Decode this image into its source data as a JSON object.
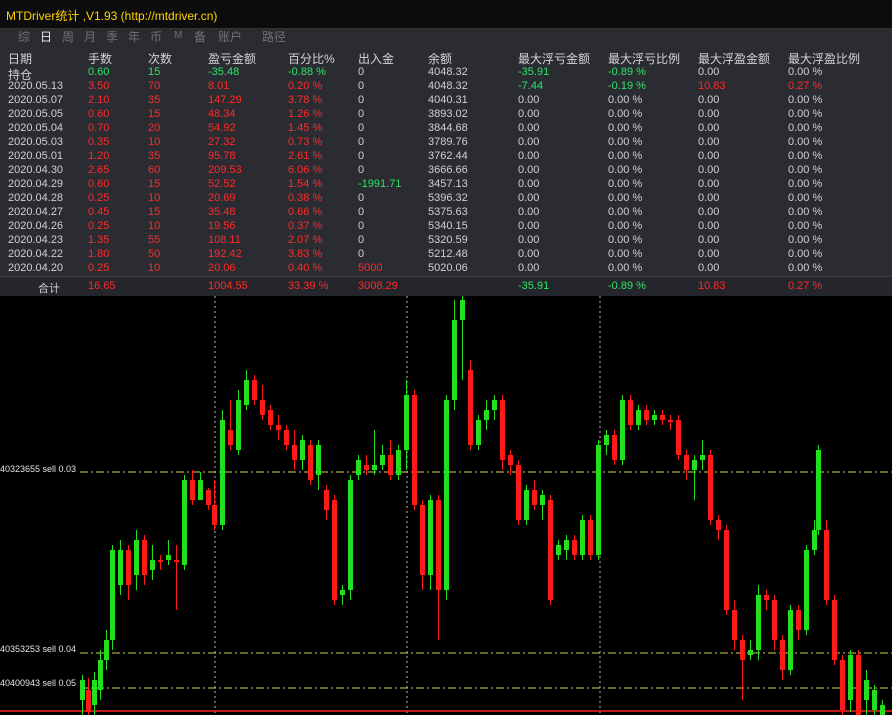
{
  "app": {
    "title": "MTDriver统计 ,V1.93 (http://mtdriver.cn)"
  },
  "tabs": [
    {
      "label": "综",
      "active": false
    },
    {
      "label": "日",
      "active": true
    },
    {
      "label": "周",
      "active": false
    },
    {
      "label": "月",
      "active": false
    },
    {
      "label": "季",
      "active": false
    },
    {
      "label": "年",
      "active": false
    },
    {
      "label": "币",
      "active": false
    },
    {
      "label": "M",
      "active": false
    },
    {
      "label": "备",
      "active": false
    },
    {
      "label": "账户",
      "active": false
    },
    {
      "label": "路径",
      "active": false
    }
  ],
  "table": {
    "headers": [
      "日期",
      "手数",
      "次数",
      "盈亏金额",
      "百分比%",
      "出入金",
      "余额",
      "最大浮亏金额",
      "最大浮亏比例",
      "最大浮盈金额",
      "最大浮盈比例"
    ],
    "rows": [
      {
        "date": "持仓",
        "lots": "0.60",
        "count": "15",
        "pnl": "-35.48",
        "pct": "-0.88 %",
        "flow": "0",
        "balance": "4048.32",
        "maxloss": "-35.91",
        "maxlosspct": "-0.89 %",
        "maxgain": "0.00",
        "maxgainpct": "0.00 %",
        "sign": "g"
      },
      {
        "date": "2020.05.13",
        "lots": "3.50",
        "count": "70",
        "pnl": "8.01",
        "pct": "0.20 %",
        "flow": "0",
        "balance": "4048.32",
        "maxloss": "-7.44",
        "maxlosspct": "-0.19 %",
        "maxgain": "10.83",
        "maxgainpct": "0.27 %",
        "sign": "r"
      },
      {
        "date": "2020.05.07",
        "lots": "2.10",
        "count": "35",
        "pnl": "147.29",
        "pct": "3.78 %",
        "flow": "0",
        "balance": "4040.31",
        "maxloss": "0.00",
        "maxlosspct": "0.00 %",
        "maxgain": "0.00",
        "maxgainpct": "0.00 %",
        "sign": "r"
      },
      {
        "date": "2020.05.05",
        "lots": "0.60",
        "count": "15",
        "pnl": "48.34",
        "pct": "1.26 %",
        "flow": "0",
        "balance": "3893.02",
        "maxloss": "0.00",
        "maxlosspct": "0.00 %",
        "maxgain": "0.00",
        "maxgainpct": "0.00 %",
        "sign": "r"
      },
      {
        "date": "2020.05.04",
        "lots": "0.70",
        "count": "20",
        "pnl": "54.92",
        "pct": "1.45 %",
        "flow": "0",
        "balance": "3844.68",
        "maxloss": "0.00",
        "maxlosspct": "0.00 %",
        "maxgain": "0.00",
        "maxgainpct": "0.00 %",
        "sign": "r"
      },
      {
        "date": "2020.05.03",
        "lots": "0.35",
        "count": "10",
        "pnl": "27.32",
        "pct": "0.73 %",
        "flow": "0",
        "balance": "3789.76",
        "maxloss": "0.00",
        "maxlosspct": "0.00 %",
        "maxgain": "0.00",
        "maxgainpct": "0.00 %",
        "sign": "r"
      },
      {
        "date": "2020.05.01",
        "lots": "1.20",
        "count": "35",
        "pnl": "95.78",
        "pct": "2.61 %",
        "flow": "0",
        "balance": "3762.44",
        "maxloss": "0.00",
        "maxlosspct": "0.00 %",
        "maxgain": "0.00",
        "maxgainpct": "0.00 %",
        "sign": "r"
      },
      {
        "date": "2020.04.30",
        "lots": "2.65",
        "count": "60",
        "pnl": "209.53",
        "pct": "6.06 %",
        "flow": "0",
        "balance": "3666.66",
        "maxloss": "0.00",
        "maxlosspct": "0.00 %",
        "maxgain": "0.00",
        "maxgainpct": "0.00 %",
        "sign": "r"
      },
      {
        "date": "2020.04.29",
        "lots": "0.60",
        "count": "15",
        "pnl": "52.52",
        "pct": "1.54 %",
        "flow": "-1991.71",
        "balance": "3457.13",
        "maxloss": "0.00",
        "maxlosspct": "0.00 %",
        "maxgain": "0.00",
        "maxgainpct": "0.00 %",
        "sign": "r",
        "flowcolor": "g"
      },
      {
        "date": "2020.04.28",
        "lots": "0.25",
        "count": "10",
        "pnl": "20.69",
        "pct": "0.38 %",
        "flow": "0",
        "balance": "5396.32",
        "maxloss": "0.00",
        "maxlosspct": "0.00 %",
        "maxgain": "0.00",
        "maxgainpct": "0.00 %",
        "sign": "r"
      },
      {
        "date": "2020.04.27",
        "lots": "0.45",
        "count": "15",
        "pnl": "35.48",
        "pct": "0.66 %",
        "flow": "0",
        "balance": "5375.63",
        "maxloss": "0.00",
        "maxlosspct": "0.00 %",
        "maxgain": "0.00",
        "maxgainpct": "0.00 %",
        "sign": "r"
      },
      {
        "date": "2020.04.26",
        "lots": "0.25",
        "count": "10",
        "pnl": "19.56",
        "pct": "0.37 %",
        "flow": "0",
        "balance": "5340.15",
        "maxloss": "0.00",
        "maxlosspct": "0.00 %",
        "maxgain": "0.00",
        "maxgainpct": "0.00 %",
        "sign": "r"
      },
      {
        "date": "2020.04.23",
        "lots": "1.35",
        "count": "55",
        "pnl": "108.11",
        "pct": "2.07 %",
        "flow": "0",
        "balance": "5320.59",
        "maxloss": "0.00",
        "maxlosspct": "0.00 %",
        "maxgain": "0.00",
        "maxgainpct": "0.00 %",
        "sign": "r"
      },
      {
        "date": "2020.04.22",
        "lots": "1.80",
        "count": "50",
        "pnl": "192.42",
        "pct": "3.83 %",
        "flow": "0",
        "balance": "5212.48",
        "maxloss": "0.00",
        "maxlosspct": "0.00 %",
        "maxgain": "0.00",
        "maxgainpct": "0.00 %",
        "sign": "r"
      },
      {
        "date": "2020.04.20",
        "lots": "0.25",
        "count": "10",
        "pnl": "20.06",
        "pct": "0.40 %",
        "flow": "5000",
        "balance": "5020.06",
        "maxloss": "0.00",
        "maxlosspct": "0.00 %",
        "maxgain": "0.00",
        "maxgainpct": "0.00 %",
        "sign": "r",
        "flowcolor": "r"
      }
    ],
    "summary": {
      "label": "合计",
      "lots": "16.65",
      "pnl": "1004.55",
      "pct": "33.39 %",
      "flow": "3008.29",
      "maxloss": "-35.91",
      "maxlosspct": "-0.89 %",
      "maxgain": "10.83",
      "maxgainpct": "0.27 %"
    }
  },
  "levels": [
    {
      "label": "40323655 sell 0.03",
      "color": "#d8d24a"
    },
    {
      "label": "40353253 sell 0.04",
      "color": "#d8d24a"
    },
    {
      "label": "40400943 sell 0.05",
      "color": "#d8d24a"
    }
  ],
  "colors": {
    "bull": "#22e01e",
    "bear": "#ff1a1a",
    "grid": "#cccccc",
    "level": "#d8d24a",
    "accent": "#ffd400"
  }
}
